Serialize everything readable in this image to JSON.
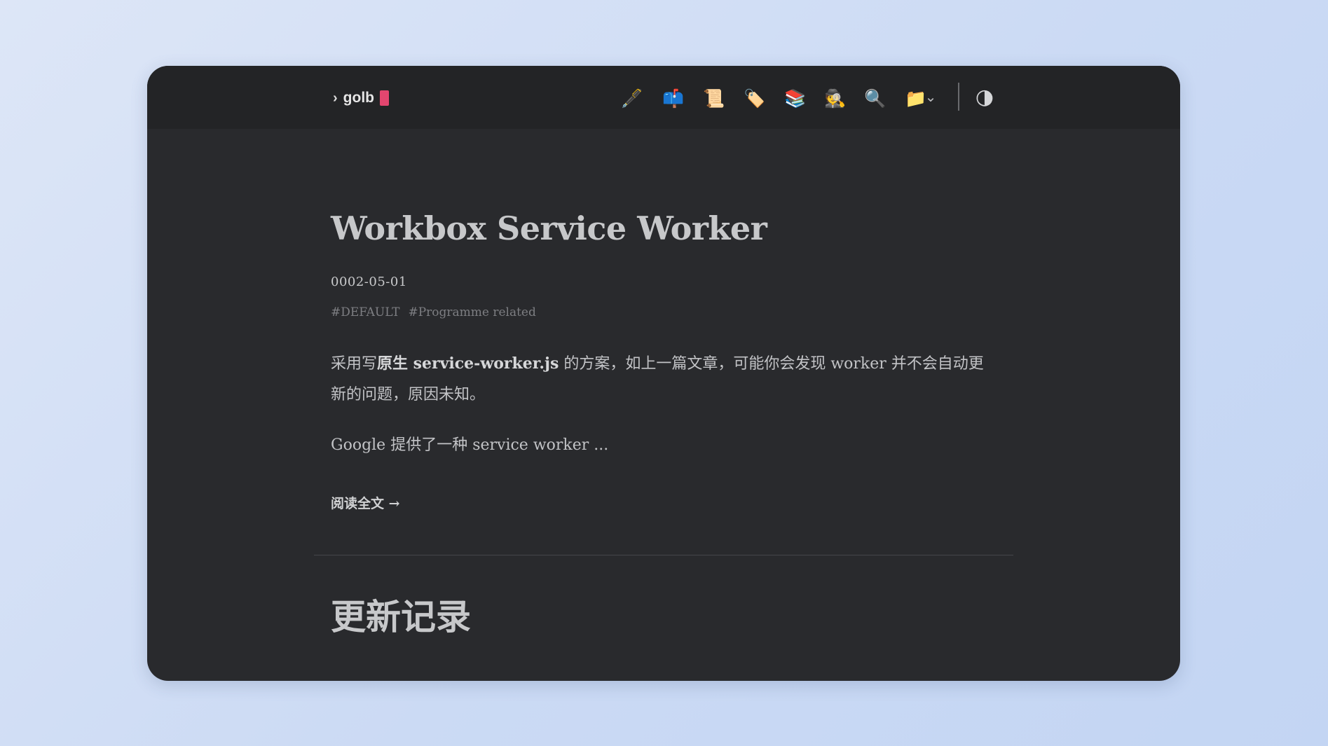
{
  "header": {
    "brand_chevron": "›",
    "brand_name": "golb",
    "nav_icons": [
      {
        "name": "pen-icon",
        "glyph": "🖋️"
      },
      {
        "name": "mailbox-icon",
        "glyph": "📫"
      },
      {
        "name": "scroll-icon",
        "glyph": "📜"
      },
      {
        "name": "tag-icon",
        "glyph": "🏷️"
      },
      {
        "name": "books-icon",
        "glyph": "📚"
      },
      {
        "name": "detective-icon",
        "glyph": "🕵️"
      },
      {
        "name": "magnifier-icon",
        "glyph": "🔍"
      },
      {
        "name": "folder-icon",
        "glyph": "📁"
      }
    ],
    "folder_dropdown_glyph": "⌄",
    "theme_toggle_glyph": "◑"
  },
  "post": {
    "title": "Workbox Service Worker",
    "date": "0002-05-01",
    "tags": [
      "#DEFAULT",
      "#Programme related"
    ],
    "excerpt_prefix": "采用写",
    "excerpt_bold": "原生 service-worker.js",
    "excerpt_suffix": " 的方案，如上一篇文章，可能你会发现 worker 并不会自动更新的问题，原因未知。",
    "excerpt_second": "Google 提供了一种 service worker ...",
    "read_more": "阅读全文 →"
  },
  "section": {
    "title": "更新记录"
  },
  "colors": {
    "background": "#292a2d",
    "topbar": "#232426",
    "accent_cursor": "#e3466f",
    "text": "#c7c8ca",
    "muted": "#7d7e82"
  }
}
